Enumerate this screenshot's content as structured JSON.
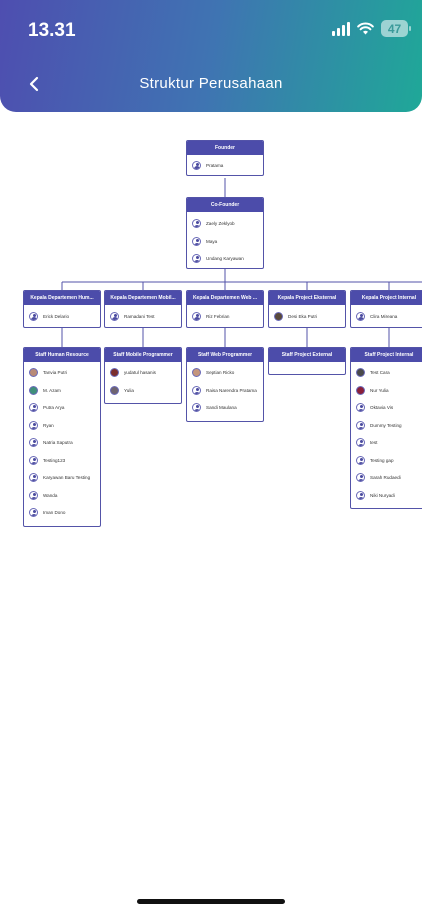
{
  "status": {
    "time": "13.31",
    "battery": "47"
  },
  "header": {
    "title": "Struktur Perusahaan"
  },
  "nodes": [
    {
      "title": "Founder",
      "members": [
        "Pratama"
      ]
    },
    {
      "title": "Co-Founder",
      "members": [
        "Zaely Zeklyob",
        "Maya",
        "Undang Karyawan"
      ]
    },
    {
      "title": "Kepala Departemen Hum...",
      "members": [
        "Erick Delario"
      ]
    },
    {
      "title": "Kepala Departemen Mobil...",
      "members": [
        "Ramadani Test"
      ]
    },
    {
      "title": "Kepala Departemen Web ...",
      "members": [
        "Riz Febrian"
      ]
    },
    {
      "title": "Kepala Project Eksternal",
      "members": [
        "Desi Eka Putri"
      ]
    },
    {
      "title": "Kepala Project Internal",
      "members": [
        "Clira Mireana"
      ]
    },
    {
      "title": "Staff Human Resource",
      "members": [
        "Tanvia Putri",
        "M. Azam",
        "Putra Arya",
        "Ryan",
        "Natria Saputra",
        "Testing123",
        "Karyawan Baru Testing",
        "Wanda",
        "Iman Dono"
      ]
    },
    {
      "title": "Staff Mobile Programmer",
      "members": [
        "yudatul hasanis",
        "Yulia"
      ]
    },
    {
      "title": "Staff Web Programmer",
      "members": [
        "Septian Ricko",
        "Raisa Narendra Pratama",
        "Sandi Maulana"
      ]
    },
    {
      "title": "Staff Project External",
      "members": []
    },
    {
      "title": "Staff Project Internal",
      "members": [
        "Test Cara",
        "Nur Yulia",
        "Oktavia Vis",
        "Dummy Testing",
        "test",
        "Testing gap",
        "Sarah Rudaedi",
        "Niki Nuryadi"
      ]
    }
  ],
  "colors": {
    "node_header": "#4c4caa",
    "connector": "#5353a8",
    "gradient_start": "#4e4eb0",
    "gradient_end": "#1fa898"
  },
  "icons": {
    "back": "chevron-left-icon",
    "avatar": "user-avatar-icon"
  }
}
